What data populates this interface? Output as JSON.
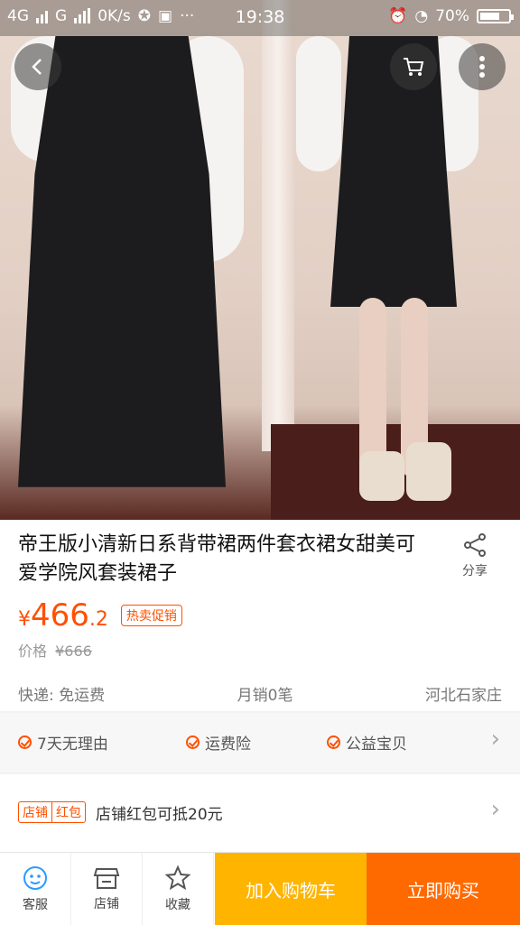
{
  "status_bar": {
    "network_1": "4G",
    "network_2": "G",
    "speed": "0K/s",
    "time": "19:38",
    "battery": "70%",
    "battery_level": 0.7
  },
  "product": {
    "title": "帝王版小清新日系背带裙两件套衣裙女甜美可爱学院风套装裙子",
    "share_label": "分享",
    "price_symbol": "¥",
    "price_int": "466",
    "price_dec": ".2",
    "promo_badge": "热卖促销",
    "orig_label": "价格",
    "orig_price": "¥666",
    "shipping": "快递: 免运费",
    "monthly_sales": "月销0笔",
    "location": "河北石家庄"
  },
  "services": {
    "items": [
      "7天无理由",
      "运费险",
      "公益宝贝"
    ]
  },
  "coupon": {
    "tag_left": "店铺",
    "tag_right": "红包",
    "text": "店铺红包可抵20元"
  },
  "bottom_bar": {
    "service_label": "客服",
    "shop_label": "店铺",
    "favorite_label": "收藏",
    "add_cart_label": "加入购物车",
    "buy_now_label": "立即购买"
  },
  "colors": {
    "accent": "#ff5000",
    "cart_button": "#ffb400",
    "buy_button": "#ff6a00"
  },
  "icons": [
    "back-icon",
    "cart-icon",
    "more-icon",
    "share-icon",
    "customer-service-icon",
    "shop-icon",
    "star-icon",
    "chevron-right-icon"
  ]
}
